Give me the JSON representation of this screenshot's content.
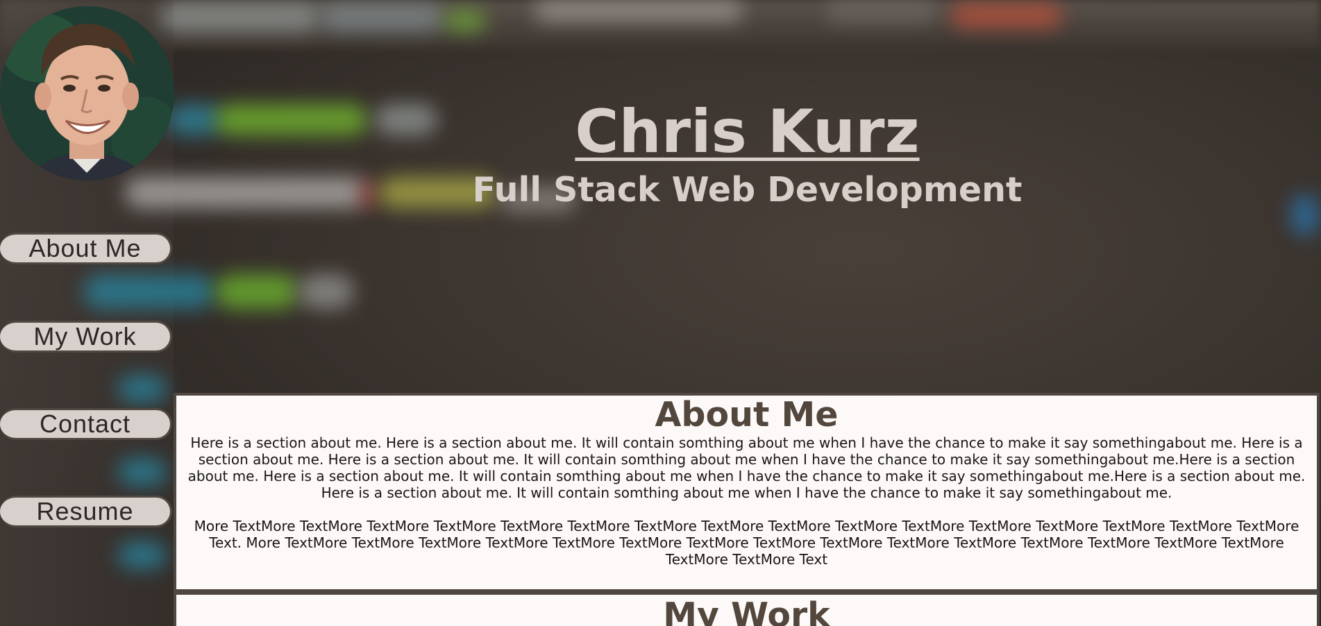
{
  "header": {
    "title": "Chris Kurz",
    "subtitle": "Full Stack Web Development"
  },
  "nav": {
    "items": [
      {
        "label": "About Me"
      },
      {
        "label": "My Work"
      },
      {
        "label": "Contact"
      },
      {
        "label": "Resume"
      }
    ]
  },
  "about": {
    "heading": "About Me",
    "paragraph1": "Here is a section about me. Here is a section about me. It will contain somthing about me when I have the chance to make it say somethingabout me. Here is a section about me. Here is a section about me. It will contain somthing about me when I have the chance to make it say somethingabout me.Here is a section about me. Here is a section about me. It will contain somthing about me when I have the chance to make it say somethingabout me.Here is a section about me. Here is a section about me. It will contain somthing about me when I have the chance to make it say somethingabout me.",
    "paragraph2": "More TextMore TextMore TextMore TextMore TextMore TextMore TextMore TextMore TextMore TextMore TextMore TextMore TextMore TextMore TextMore TextMore Text. More TextMore TextMore TextMore TextMore TextMore TextMore TextMore TextMore TextMore TextMore TextMore TextMore TextMore TextMore TextMore TextMore TextMore Text"
  },
  "work": {
    "heading": "My Work"
  },
  "colors": {
    "panel_border": "#514741",
    "heading": "#52463d",
    "header_text": "#d9cfca",
    "nav_button": "#d8d0cc"
  }
}
